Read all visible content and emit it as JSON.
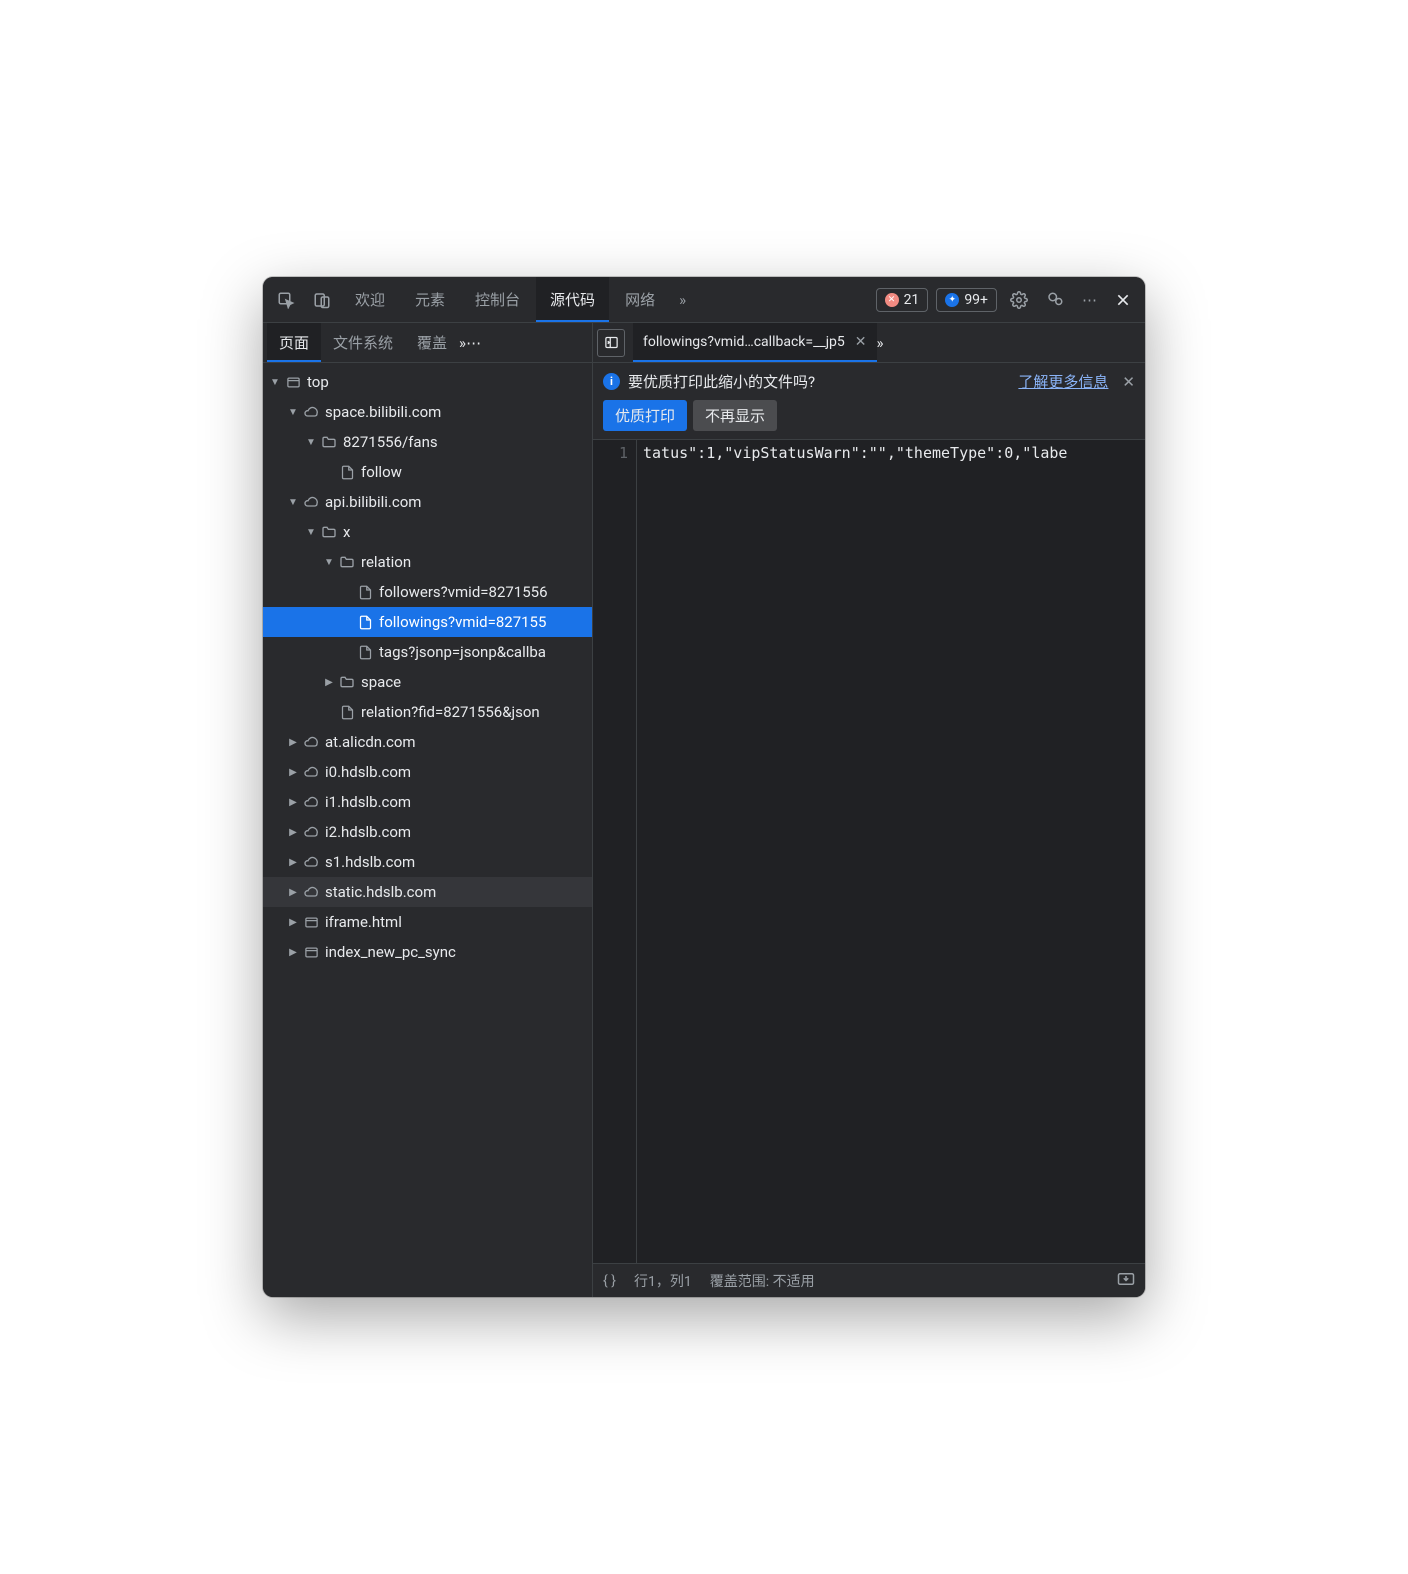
{
  "toolbar": {
    "tabs": {
      "welcome": "欢迎",
      "elements": "元素",
      "console": "控制台",
      "sources": "源代码",
      "network": "网络"
    },
    "error_count": "21",
    "message_count": "99+"
  },
  "left": {
    "tabs": {
      "page": "页面",
      "filesystem": "文件系统",
      "overrides": "覆盖"
    },
    "tree": [
      {
        "indent": 0,
        "arrow": "down",
        "icon": "window",
        "label": "top"
      },
      {
        "indent": 1,
        "arrow": "down",
        "icon": "cloud",
        "label": "space.bilibili.com"
      },
      {
        "indent": 2,
        "arrow": "down",
        "icon": "folder",
        "label": "8271556/fans"
      },
      {
        "indent": 3,
        "arrow": "",
        "icon": "file",
        "label": "follow"
      },
      {
        "indent": 1,
        "arrow": "down",
        "icon": "cloud",
        "label": "api.bilibili.com"
      },
      {
        "indent": 2,
        "arrow": "down",
        "icon": "folder",
        "label": "x"
      },
      {
        "indent": 3,
        "arrow": "down",
        "icon": "folder",
        "label": "relation"
      },
      {
        "indent": 4,
        "arrow": "",
        "icon": "file",
        "label": "followers?vmid=8271556"
      },
      {
        "indent": 4,
        "arrow": "",
        "icon": "file",
        "label": "followings?vmid=827155",
        "selected": true
      },
      {
        "indent": 4,
        "arrow": "",
        "icon": "file",
        "label": "tags?jsonp=jsonp&callba"
      },
      {
        "indent": 3,
        "arrow": "right",
        "icon": "folder",
        "label": "space"
      },
      {
        "indent": 3,
        "arrow": "",
        "icon": "file",
        "label": "relation?fid=8271556&json"
      },
      {
        "indent": 1,
        "arrow": "right",
        "icon": "cloud",
        "label": "at.alicdn.com"
      },
      {
        "indent": 1,
        "arrow": "right",
        "icon": "cloud",
        "label": "i0.hdslb.com"
      },
      {
        "indent": 1,
        "arrow": "right",
        "icon": "cloud",
        "label": "i1.hdslb.com"
      },
      {
        "indent": 1,
        "arrow": "right",
        "icon": "cloud",
        "label": "i2.hdslb.com"
      },
      {
        "indent": 1,
        "arrow": "right",
        "icon": "cloud",
        "label": "s1.hdslb.com"
      },
      {
        "indent": 1,
        "arrow": "right",
        "icon": "cloud",
        "label": "static.hdslb.com",
        "highlighted": true
      },
      {
        "indent": 1,
        "arrow": "right",
        "icon": "window",
        "label": "iframe.html"
      },
      {
        "indent": 1,
        "arrow": "right",
        "icon": "window",
        "label": "index_new_pc_sync"
      }
    ]
  },
  "file_tab": {
    "label": "followings?vmid…callback=__jp5"
  },
  "info": {
    "question": "要优质打印此缩小的文件吗?",
    "learn_more": "了解更多信息",
    "pretty_print": "优质打印",
    "dont_show": "不再显示"
  },
  "code": {
    "line_number": "1",
    "content": "tatus\":1,\"vipStatusWarn\":\"\",\"themeType\":0,\"labe"
  },
  "status": {
    "braces": "{ }",
    "cursor": "行1，列1",
    "coverage": "覆盖范围: 不适用"
  }
}
